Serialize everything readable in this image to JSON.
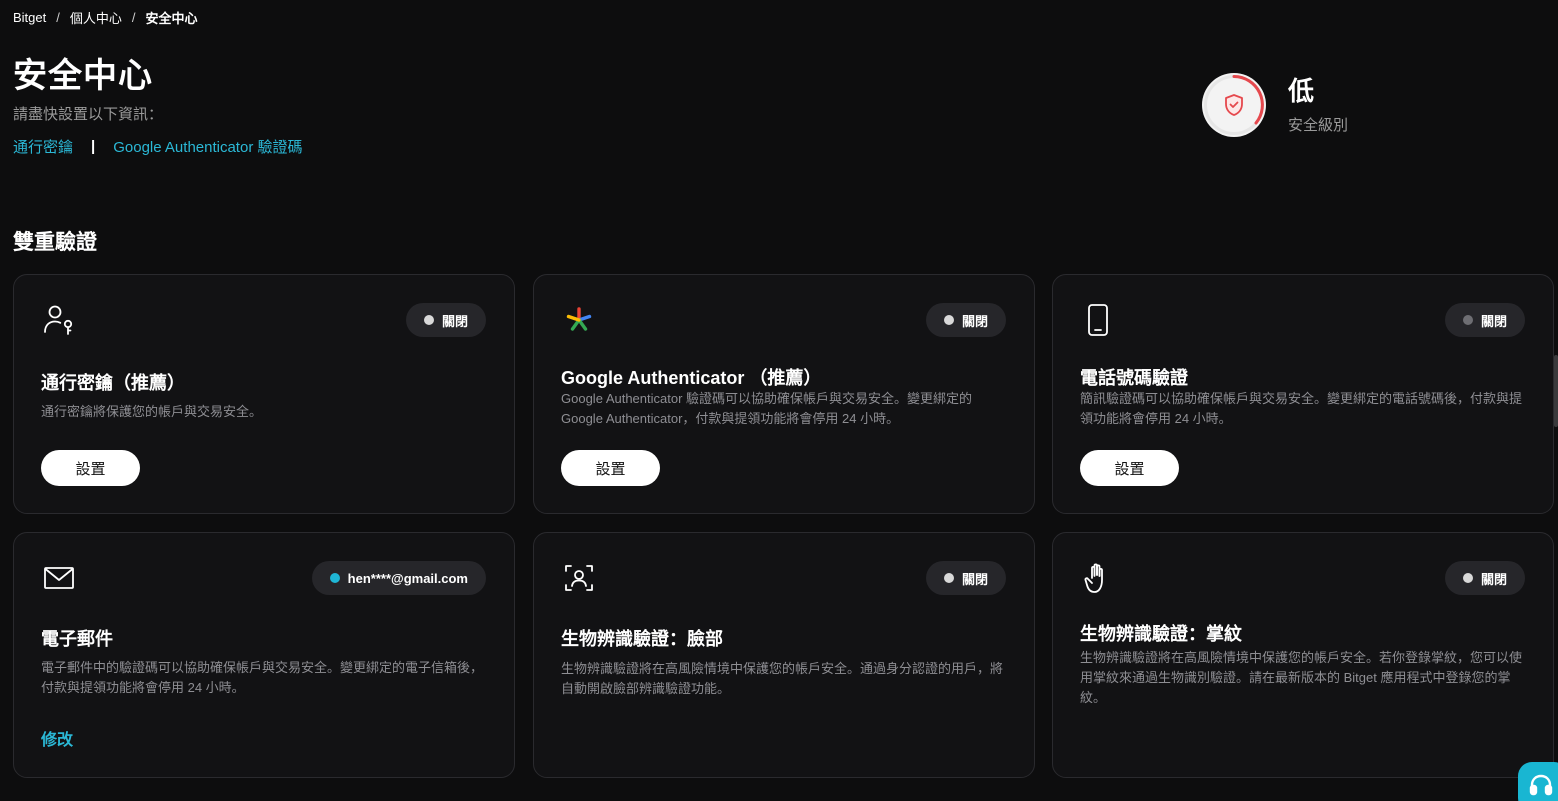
{
  "breadcrumb": {
    "items": [
      "Bitget",
      "個人中心",
      "安全中心"
    ],
    "separator": "/"
  },
  "header": {
    "title": "安全中心",
    "subtitle": "請盡快設置以下資訊：",
    "links": [
      "通行密鑰",
      "Google Authenticator 驗證碼"
    ],
    "link_divider": "|"
  },
  "security_level": {
    "value": "低",
    "label": "安全級別",
    "color": "#e5484d"
  },
  "section": {
    "title": "雙重驗證"
  },
  "colors": {
    "accent": "#2bb8d6",
    "status_off_dot": "#d9d9d9",
    "status_on_dot": "#1fb6d6"
  },
  "cards": [
    {
      "icon": "user-key-icon",
      "title": "通行密鑰（推薦）",
      "desc": "通行密鑰將保護您的帳戶與交易安全。",
      "status": "關閉",
      "action": "設置"
    },
    {
      "icon": "google-authenticator-icon",
      "title": "Google Authenticator （推薦）",
      "desc": "Google Authenticator 驗證碼可以協助確保帳戶與交易安全。變更綁定的 Google Authenticator，付款與提領功能將會停用 24 小時。",
      "status": "關閉",
      "action": "設置"
    },
    {
      "icon": "phone-icon",
      "title": "電話號碼驗證",
      "desc": "簡訊驗證碼可以協助確保帳戶與交易安全。變更綁定的電話號碼後，付款與提領功能將會停用 24 小時。",
      "status": "關閉",
      "action": "設置"
    },
    {
      "icon": "mail-icon",
      "title": "電子郵件",
      "desc": "電子郵件中的驗證碼可以協助確保帳戶與交易安全。變更綁定的電子信箱後，付款與提領功能將會停用 24 小時。",
      "status": "hen****@gmail.com",
      "action": "修改"
    },
    {
      "icon": "face-scan-icon",
      "title": "生物辨識驗證：臉部",
      "desc": "生物辨識驗證將在高風險情境中保護您的帳戶安全。通過身分認證的用戶，將自動開啟臉部辨識驗證功能。",
      "status": "關閉"
    },
    {
      "icon": "palm-icon",
      "title": "生物辨識驗證：掌紋",
      "desc": "生物辨識驗證將在高風險情境中保護您的帳戶安全。若你登錄掌紋，您可以使用掌紋來通過生物識別驗證。請在最新版本的 Bitget 應用程式中登錄您的掌紋。",
      "status": "關閉"
    }
  ],
  "support": {
    "icon": "headset-icon"
  }
}
